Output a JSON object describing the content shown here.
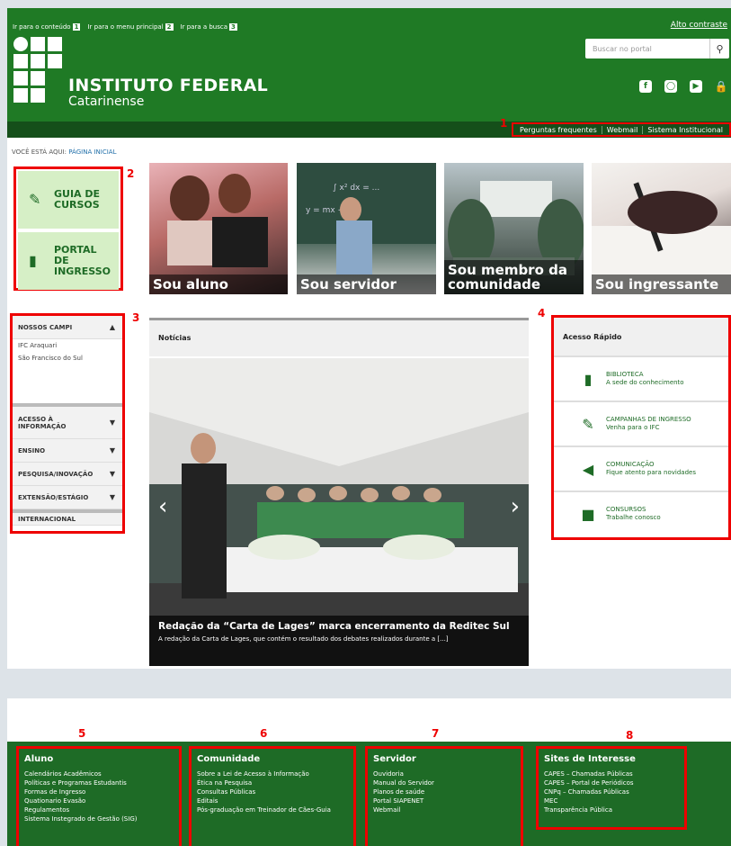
{
  "header": {
    "skip_links": [
      {
        "label": "Ir para o conteúdo",
        "key": "1"
      },
      {
        "label": "Ir para o menu principal",
        "key": "2"
      },
      {
        "label": "Ir para a busca",
        "key": "3"
      }
    ],
    "contrast_label": "Alto contraste",
    "search_placeholder": "Buscar no portal",
    "logo_line1": "INSTITUTO FEDERAL",
    "logo_line2": "Catarinense",
    "social_icons": [
      "facebook-icon",
      "instagram-icon",
      "youtube-icon",
      "lock-icon"
    ]
  },
  "toplinks": [
    "Perguntas frequentes",
    "Webmail",
    "Sistema Institucional"
  ],
  "annotations": [
    "1",
    "2",
    "3",
    "4",
    "5",
    "6",
    "7",
    "8"
  ],
  "breadcrumb": {
    "prefix": "VOCÊ ESTÁ AQUI:",
    "current": "PÁGINA INICIAL"
  },
  "quick_buttons": [
    {
      "label": "GUIA DE CURSOS",
      "icon": "pencil-icon"
    },
    {
      "label": "PORTAL DE INGRESSO",
      "icon": "book-icon"
    }
  ],
  "profiles": [
    "Sou aluno",
    "Sou servidor",
    "Sou membro da comunidade",
    "Sou ingressante"
  ],
  "menu": {
    "items": [
      {
        "label": "NOSSOS CAMPI",
        "expanded": true,
        "sub": [
          "IFC Araquari",
          "São Francisco do Sul"
        ]
      },
      {
        "label": "ACESSO À INFORMAÇÃO"
      },
      {
        "label": "ENSINO"
      },
      {
        "label": "PESQUISA/INOVAÇÃO"
      },
      {
        "label": "EXTENSÃO/ESTÁGIO"
      },
      {
        "label": "INTERNACIONAL"
      }
    ]
  },
  "news": {
    "heading": "Notícias",
    "title": "Redação da “Carta de Lages” marca encerramento da Reditec Sul",
    "desc": "A redação da Carta de Lages, que contém o resultado dos debates realizados durante a [...]"
  },
  "access": {
    "heading": "Acesso Rápido",
    "items": [
      {
        "title": "BIBLIOTECA",
        "sub": "A sede do conhecimento",
        "icon": "book-icon"
      },
      {
        "title": "CAMPANHAS DE INGRESSO",
        "sub": "Venha para o IFC",
        "icon": "pencil-icon"
      },
      {
        "title": "COMUNICAÇÃO",
        "sub": "Fique atento para novidades",
        "icon": "megaphone-icon"
      },
      {
        "title": "CONSURSOS",
        "sub": "Trabalhe conosco",
        "icon": "contact-card-icon"
      }
    ]
  },
  "footer": [
    {
      "heading": "Aluno",
      "items": [
        "Calendários Acadêmicos",
        "Políticas e Programas Estudantis",
        "Formas de Ingresso",
        "Quationario Evasão",
        "Regulamentos",
        "Sistema Instegrado de Gestão (SIG)"
      ]
    },
    {
      "heading": "Comunidade",
      "items": [
        "Sobre a Lei de Acesso à Informação",
        "Ética na Pesquisa",
        "Consultas Públicas",
        "Editais",
        "Pós-graduação em Treinador de Cães-Guia"
      ]
    },
    {
      "heading": "Servidor",
      "items": [
        "Ouvidoria",
        "Manual do Servidor",
        "Planos de saúde",
        "Portal SIAPENET",
        "Webmail"
      ]
    },
    {
      "heading": "Sites de Interesse",
      "items": [
        "CAPES – Chamadas Públicas",
        "CAPES – Portal de Periódicos",
        "CNPq – Chamadas Públicas",
        "MEC",
        "Transparência Pública"
      ]
    }
  ]
}
